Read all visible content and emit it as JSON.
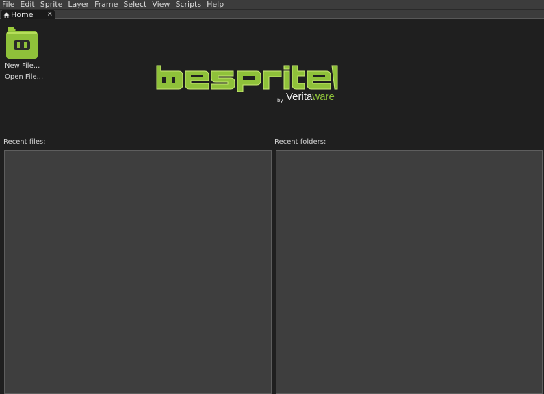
{
  "menubar": {
    "items": [
      {
        "pre": "",
        "acc": "F",
        "post": "ile"
      },
      {
        "pre": "",
        "acc": "E",
        "post": "dit"
      },
      {
        "pre": "",
        "acc": "S",
        "post": "prite"
      },
      {
        "pre": "",
        "acc": "L",
        "post": "ayer"
      },
      {
        "pre": "F",
        "acc": "r",
        "post": "ame"
      },
      {
        "pre": "Selec",
        "acc": "t",
        "post": ""
      },
      {
        "pre": "",
        "acc": "V",
        "post": "iew"
      },
      {
        "pre": "Scr",
        "acc": "i",
        "post": "pts"
      },
      {
        "pre": "",
        "acc": "H",
        "post": "elp"
      }
    ]
  },
  "tabs": [
    {
      "label": "Home",
      "icon": "home-icon",
      "close": "×"
    }
  ],
  "home": {
    "new_file": "New File...",
    "open_file": "Open File...",
    "logo_text": "Libresprite",
    "logo_by": "by",
    "logo_company_a": "Verita",
    "logo_company_b": "ware",
    "recent_files_label": "Recent files:",
    "recent_folders_label": "Recent folders:"
  },
  "colors": {
    "accent_green": "#8fc13a",
    "background": "#1f1f1f",
    "panel": "#3e3e3e",
    "menubar": "#3c3c3c"
  }
}
